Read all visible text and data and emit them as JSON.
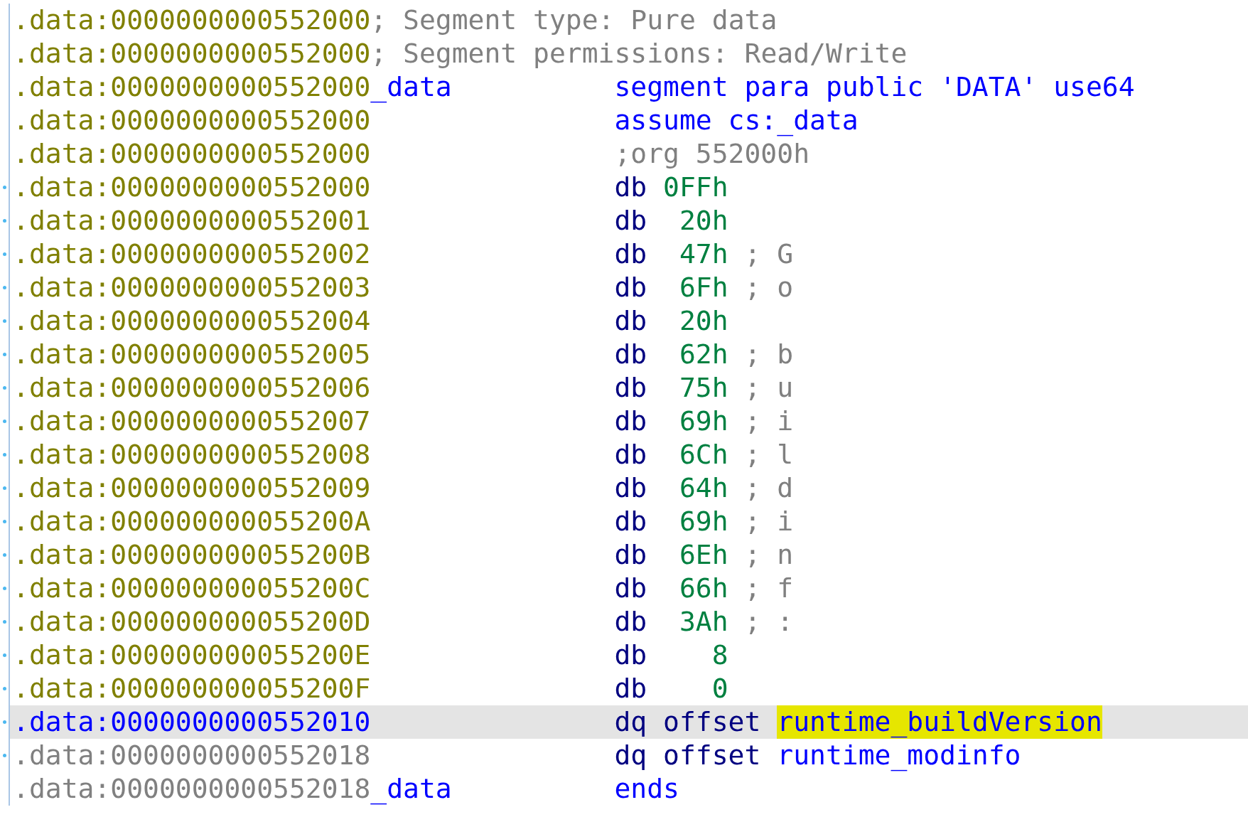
{
  "listing": {
    "rows": [
      {
        "address": ".data:0000000000552000",
        "kind": "data",
        "selected": false,
        "marked": false,
        "label": {
          "text": "; Segment type: Pure data",
          "kind": "comment"
        },
        "body": []
      },
      {
        "address": ".data:0000000000552000",
        "kind": "data",
        "selected": false,
        "marked": false,
        "label": {
          "text": "; Segment permissions: Read/Write",
          "kind": "comment"
        },
        "body": []
      },
      {
        "address": ".data:0000000000552000",
        "kind": "data",
        "selected": false,
        "marked": false,
        "label": {
          "text": "_data",
          "kind": "name"
        },
        "body": [
          {
            "text": "segment para public 'DATA' use64",
            "kind": "directive"
          }
        ]
      },
      {
        "address": ".data:0000000000552000",
        "kind": "data",
        "selected": false,
        "marked": false,
        "body": [
          {
            "text": "assume cs:_data",
            "kind": "directive"
          }
        ]
      },
      {
        "address": ".data:0000000000552000",
        "kind": "data",
        "selected": false,
        "marked": false,
        "body": [
          {
            "text": ";org 552000h",
            "kind": "comment"
          }
        ]
      },
      {
        "address": ".data:0000000000552000",
        "kind": "data",
        "selected": false,
        "marked": true,
        "body": [
          {
            "text": "db",
            "kind": "instruction"
          },
          {
            "text": "0FFh",
            "kind": "number"
          }
        ]
      },
      {
        "address": ".data:0000000000552001",
        "kind": "data",
        "selected": false,
        "marked": true,
        "body": [
          {
            "text": "db",
            "kind": "instruction"
          },
          {
            "text": "20h",
            "kind": "number"
          }
        ]
      },
      {
        "address": ".data:0000000000552002",
        "kind": "data",
        "selected": false,
        "marked": true,
        "body": [
          {
            "text": "db",
            "kind": "instruction"
          },
          {
            "text": "47h",
            "kind": "number"
          },
          {
            "text": "; G",
            "kind": "comment"
          }
        ]
      },
      {
        "address": ".data:0000000000552003",
        "kind": "data",
        "selected": false,
        "marked": true,
        "body": [
          {
            "text": "db",
            "kind": "instruction"
          },
          {
            "text": "6Fh",
            "kind": "number"
          },
          {
            "text": "; o",
            "kind": "comment"
          }
        ]
      },
      {
        "address": ".data:0000000000552004",
        "kind": "data",
        "selected": false,
        "marked": true,
        "body": [
          {
            "text": "db",
            "kind": "instruction"
          },
          {
            "text": "20h",
            "kind": "number"
          }
        ]
      },
      {
        "address": ".data:0000000000552005",
        "kind": "data",
        "selected": false,
        "marked": true,
        "body": [
          {
            "text": "db",
            "kind": "instruction"
          },
          {
            "text": "62h",
            "kind": "number"
          },
          {
            "text": "; b",
            "kind": "comment"
          }
        ]
      },
      {
        "address": ".data:0000000000552006",
        "kind": "data",
        "selected": false,
        "marked": true,
        "body": [
          {
            "text": "db",
            "kind": "instruction"
          },
          {
            "text": "75h",
            "kind": "number"
          },
          {
            "text": "; u",
            "kind": "comment"
          }
        ]
      },
      {
        "address": ".data:0000000000552007",
        "kind": "data",
        "selected": false,
        "marked": true,
        "body": [
          {
            "text": "db",
            "kind": "instruction"
          },
          {
            "text": "69h",
            "kind": "number"
          },
          {
            "text": "; i",
            "kind": "comment"
          }
        ]
      },
      {
        "address": ".data:0000000000552008",
        "kind": "data",
        "selected": false,
        "marked": true,
        "body": [
          {
            "text": "db",
            "kind": "instruction"
          },
          {
            "text": "6Ch",
            "kind": "number"
          },
          {
            "text": "; l",
            "kind": "comment"
          }
        ]
      },
      {
        "address": ".data:0000000000552009",
        "kind": "data",
        "selected": false,
        "marked": true,
        "body": [
          {
            "text": "db",
            "kind": "instruction"
          },
          {
            "text": "64h",
            "kind": "number"
          },
          {
            "text": "; d",
            "kind": "comment"
          }
        ]
      },
      {
        "address": ".data:000000000055200A",
        "kind": "data",
        "selected": false,
        "marked": true,
        "body": [
          {
            "text": "db",
            "kind": "instruction"
          },
          {
            "text": "69h",
            "kind": "number"
          },
          {
            "text": "; i",
            "kind": "comment"
          }
        ]
      },
      {
        "address": ".data:000000000055200B",
        "kind": "data",
        "selected": false,
        "marked": true,
        "body": [
          {
            "text": "db",
            "kind": "instruction"
          },
          {
            "text": "6Eh",
            "kind": "number"
          },
          {
            "text": "; n",
            "kind": "comment"
          }
        ]
      },
      {
        "address": ".data:000000000055200C",
        "kind": "data",
        "selected": false,
        "marked": true,
        "body": [
          {
            "text": "db",
            "kind": "instruction"
          },
          {
            "text": "66h",
            "kind": "number"
          },
          {
            "text": "; f",
            "kind": "comment"
          }
        ]
      },
      {
        "address": ".data:000000000055200D",
        "kind": "data",
        "selected": false,
        "marked": true,
        "body": [
          {
            "text": "db",
            "kind": "instruction"
          },
          {
            "text": "3Ah",
            "kind": "number"
          },
          {
            "text": "; :",
            "kind": "comment"
          }
        ]
      },
      {
        "address": ".data:000000000055200E",
        "kind": "data",
        "selected": false,
        "marked": true,
        "body": [
          {
            "text": "db",
            "kind": "instruction"
          },
          {
            "text": "8",
            "kind": "number"
          }
        ]
      },
      {
        "address": ".data:000000000055200F",
        "kind": "data",
        "selected": false,
        "marked": true,
        "body": [
          {
            "text": "db",
            "kind": "instruction"
          },
          {
            "text": "0",
            "kind": "number"
          }
        ]
      },
      {
        "address": ".data:0000000000552010",
        "kind": "data",
        "selected": true,
        "marked": true,
        "body": [
          {
            "text": "dq",
            "kind": "instruction"
          },
          {
            "text": "offset",
            "kind": "instruction"
          },
          {
            "text": "runtime_buildVersion",
            "kind": "name",
            "highlighted": true
          }
        ]
      },
      {
        "address": ".data:0000000000552018",
        "kind": "tail",
        "selected": false,
        "marked": true,
        "body": [
          {
            "text": "dq",
            "kind": "instruction"
          },
          {
            "text": "offset",
            "kind": "instruction"
          },
          {
            "text": "runtime_modinfo",
            "kind": "name",
            "highlighted": false
          }
        ]
      },
      {
        "address": ".data:0000000000552018",
        "kind": "tail",
        "selected": false,
        "marked": false,
        "label": {
          "text": "_data",
          "kind": "name"
        },
        "body": [
          {
            "text": "ends",
            "kind": "directive"
          }
        ]
      }
    ]
  }
}
